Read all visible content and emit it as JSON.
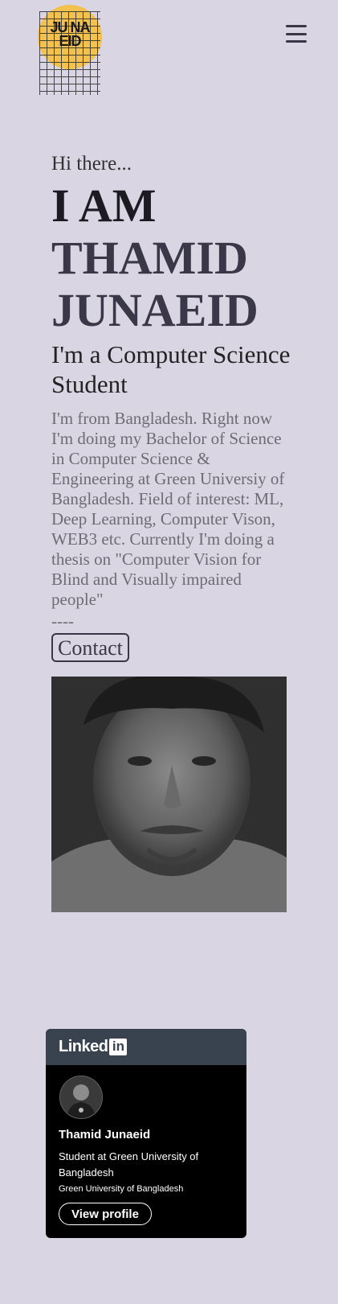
{
  "header": {
    "logo_text": "JU NA\nEID",
    "menu_icon": "hamburger-menu-icon"
  },
  "hero": {
    "greeting": "Hi there...",
    "headline_line1": "I AM",
    "headline_line2": "THAMID",
    "headline_line3": "JUNAEID",
    "subtitle": "I'm a Computer Science Student",
    "bio": "I'm from Bangladesh. Right now I'm doing my Bachelor of Science in Computer Science & Engineering at Green Universiy of Bangladesh. Field of interest: ML, Deep Learning, Computer Vison, WEB3 etc. Currently I'm doing a thesis on \"Computer Vision for Blind and Visually impaired people\"",
    "divider": "----",
    "contact_label": "Contact"
  },
  "linkedin_badge": {
    "brand": "Linked",
    "brand_in": "in",
    "name": "Thamid Junaeid",
    "headline": "Student at Green University of Bangladesh",
    "organization": "Green University of Bangladesh",
    "view_profile_label": "View profile"
  },
  "colors": {
    "background": "#d9d5e2",
    "logo_yellow": "#f2c14e",
    "heading_dark": "#3a3848",
    "linkedin_header": "#38434f"
  }
}
